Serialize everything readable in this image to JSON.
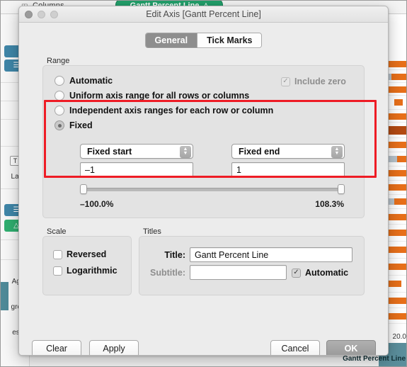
{
  "background": {
    "shelf_label": "Columns",
    "shelf_icon": "columns-icon",
    "pill_label": "Gantt Percent Line",
    "pill_warning_icon": "warning-triangle-icon",
    "marks_label": "Label",
    "marks_text_icon": "T",
    "left_texts": [
      "Aggr.",
      "gress",
      "essiv"
    ],
    "axis_tick": "20.0",
    "axis_title": "Gantt Percent Line"
  },
  "dialog": {
    "title": "Edit Axis [Gantt Percent Line]",
    "traffic_lights": [
      "close-button",
      "minimize-button",
      "zoom-button"
    ],
    "tabs": [
      {
        "label": "General",
        "active": true
      },
      {
        "label": "Tick Marks",
        "active": false
      }
    ],
    "range": {
      "group_label": "Range",
      "options": [
        {
          "label": "Automatic",
          "selected": false
        },
        {
          "label": "Uniform axis range for all rows or columns",
          "selected": false
        },
        {
          "label": "Independent axis ranges for each row or column",
          "selected": false
        },
        {
          "label": "Fixed",
          "selected": true
        }
      ],
      "include_zero": {
        "label": "Include zero",
        "checked": true,
        "enabled": false
      },
      "start_select": "Fixed start",
      "end_select": "Fixed end",
      "start_value": "–1",
      "end_value": "1",
      "min_readout": "–100.0%",
      "max_readout": "108.3%"
    },
    "scale": {
      "group_label": "Scale",
      "options": [
        {
          "label": "Reversed",
          "checked": false
        },
        {
          "label": "Logarithmic",
          "checked": false
        }
      ]
    },
    "titles": {
      "group_label": "Titles",
      "title_label": "Title:",
      "title_value": "Gantt Percent Line",
      "subtitle_label": "Subtitle:",
      "subtitle_value": "",
      "automatic_label": "Automatic",
      "automatic_checked": true
    },
    "buttons": {
      "clear": "Clear",
      "apply": "Apply",
      "cancel": "Cancel",
      "ok": "OK"
    }
  },
  "annotation": {
    "color": "#ee1c25"
  }
}
